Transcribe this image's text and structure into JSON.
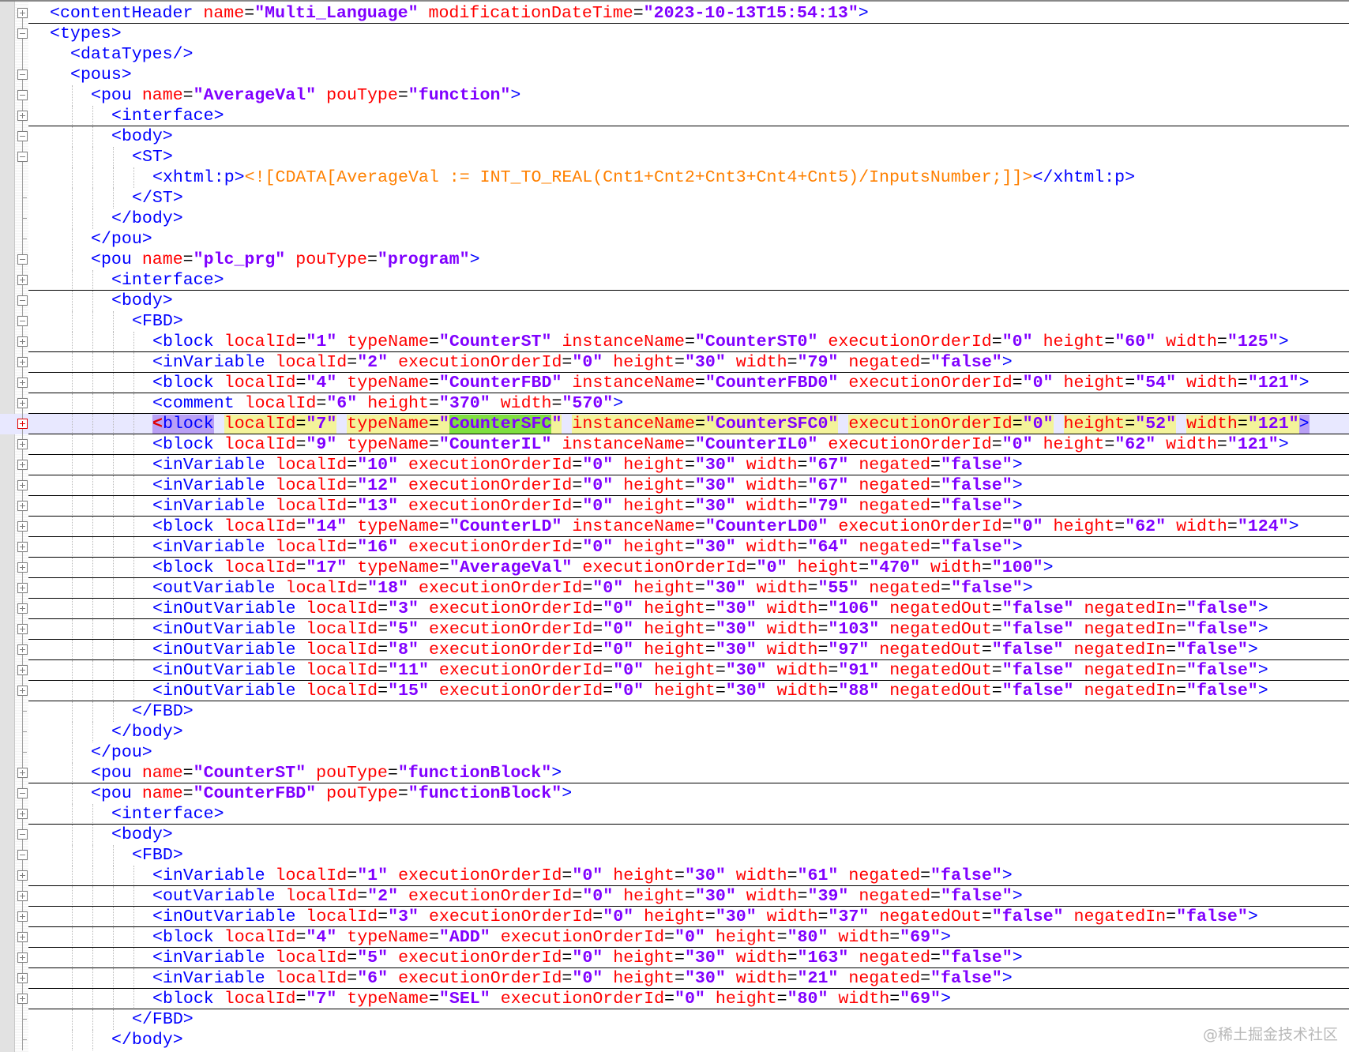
{
  "editor": {
    "lines": [
      {
        "i": 0,
        "f": "plus",
        "t": "<contentHeader name=\"Multi_Language\" modificationDateTime=\"2023-10-13T15:54:13\">"
      },
      {
        "i": 0,
        "f": "minus",
        "t": "<types>"
      },
      {
        "i": 1,
        "f": "none",
        "t": "<dataTypes/>"
      },
      {
        "i": 1,
        "f": "minus",
        "t": "<pous>"
      },
      {
        "i": 2,
        "f": "minus",
        "t": "<pou name=\"AverageVal\" pouType=\"function\">"
      },
      {
        "i": 3,
        "f": "plus",
        "t": "<interface>"
      },
      {
        "i": 3,
        "f": "minus",
        "t": "<body>"
      },
      {
        "i": 4,
        "f": "minus",
        "t": "<ST>"
      },
      {
        "i": 5,
        "f": "none",
        "t": "<xhtml:p><![CDATA[AverageVal := INT_TO_REAL(Cnt1+Cnt2+Cnt3+Cnt4+Cnt5)/InputsNumber;]]></xhtml:p>"
      },
      {
        "i": 4,
        "f": "end",
        "t": "</ST>"
      },
      {
        "i": 3,
        "f": "end",
        "t": "</body>"
      },
      {
        "i": 2,
        "f": "end",
        "t": "</pou>"
      },
      {
        "i": 2,
        "f": "minus",
        "t": "<pou name=\"plc_prg\" pouType=\"program\">"
      },
      {
        "i": 3,
        "f": "plus",
        "t": "<interface>"
      },
      {
        "i": 3,
        "f": "minus",
        "t": "<body>"
      },
      {
        "i": 4,
        "f": "minus",
        "t": "<FBD>"
      },
      {
        "i": 5,
        "f": "plus",
        "t": "<block localId=\"1\" typeName=\"CounterST\" instanceName=\"CounterST0\" executionOrderId=\"0\" height=\"60\" width=\"125\">"
      },
      {
        "i": 5,
        "f": "plus",
        "t": "<inVariable localId=\"2\" executionOrderId=\"0\" height=\"30\" width=\"79\" negated=\"false\">"
      },
      {
        "i": 5,
        "f": "plus",
        "t": "<block localId=\"4\" typeName=\"CounterFBD\" instanceName=\"CounterFBD0\" executionOrderId=\"0\" height=\"54\" width=\"121\">"
      },
      {
        "i": 5,
        "f": "plus",
        "t": "<comment localId=\"6\" height=\"370\" width=\"570\">"
      },
      {
        "i": 5,
        "f": "plus",
        "t": "<block localId=\"7\" typeName=\"CounterSFC\" instanceName=\"CounterSFC0\" executionOrderId=\"0\" height=\"52\" width=\"121\">",
        "hl": true,
        "match": "CounterSFC"
      },
      {
        "i": 5,
        "f": "plus",
        "t": "<block localId=\"9\" typeName=\"CounterIL\" instanceName=\"CounterIL0\" executionOrderId=\"0\" height=\"62\" width=\"121\">"
      },
      {
        "i": 5,
        "f": "plus",
        "t": "<inVariable localId=\"10\" executionOrderId=\"0\" height=\"30\" width=\"67\" negated=\"false\">"
      },
      {
        "i": 5,
        "f": "plus",
        "t": "<inVariable localId=\"12\" executionOrderId=\"0\" height=\"30\" width=\"67\" negated=\"false\">"
      },
      {
        "i": 5,
        "f": "plus",
        "t": "<inVariable localId=\"13\" executionOrderId=\"0\" height=\"30\" width=\"79\" negated=\"false\">"
      },
      {
        "i": 5,
        "f": "plus",
        "t": "<block localId=\"14\" typeName=\"CounterLD\" instanceName=\"CounterLD0\" executionOrderId=\"0\" height=\"62\" width=\"124\">"
      },
      {
        "i": 5,
        "f": "plus",
        "t": "<inVariable localId=\"16\" executionOrderId=\"0\" height=\"30\" width=\"64\" negated=\"false\">"
      },
      {
        "i": 5,
        "f": "plus",
        "t": "<block localId=\"17\" typeName=\"AverageVal\" executionOrderId=\"0\" height=\"470\" width=\"100\">"
      },
      {
        "i": 5,
        "f": "plus",
        "t": "<outVariable localId=\"18\" executionOrderId=\"0\" height=\"30\" width=\"55\" negated=\"false\">"
      },
      {
        "i": 5,
        "f": "plus",
        "t": "<inOutVariable localId=\"3\" executionOrderId=\"0\" height=\"30\" width=\"106\" negatedOut=\"false\" negatedIn=\"false\">"
      },
      {
        "i": 5,
        "f": "plus",
        "t": "<inOutVariable localId=\"5\" executionOrderId=\"0\" height=\"30\" width=\"103\" negatedOut=\"false\" negatedIn=\"false\">"
      },
      {
        "i": 5,
        "f": "plus",
        "t": "<inOutVariable localId=\"8\" executionOrderId=\"0\" height=\"30\" width=\"97\" negatedOut=\"false\" negatedIn=\"false\">"
      },
      {
        "i": 5,
        "f": "plus",
        "t": "<inOutVariable localId=\"11\" executionOrderId=\"0\" height=\"30\" width=\"91\" negatedOut=\"false\" negatedIn=\"false\">"
      },
      {
        "i": 5,
        "f": "plus",
        "t": "<inOutVariable localId=\"15\" executionOrderId=\"0\" height=\"30\" width=\"88\" negatedOut=\"false\" negatedIn=\"false\">"
      },
      {
        "i": 4,
        "f": "end",
        "t": "</FBD>"
      },
      {
        "i": 3,
        "f": "end",
        "t": "</body>"
      },
      {
        "i": 2,
        "f": "end",
        "t": "</pou>"
      },
      {
        "i": 2,
        "f": "plus",
        "t": "<pou name=\"CounterST\" pouType=\"functionBlock\">"
      },
      {
        "i": 2,
        "f": "minus",
        "t": "<pou name=\"CounterFBD\" pouType=\"functionBlock\">"
      },
      {
        "i": 3,
        "f": "plus",
        "t": "<interface>"
      },
      {
        "i": 3,
        "f": "minus",
        "t": "<body>"
      },
      {
        "i": 4,
        "f": "minus",
        "t": "<FBD>"
      },
      {
        "i": 5,
        "f": "plus",
        "t": "<inVariable localId=\"1\" executionOrderId=\"0\" height=\"30\" width=\"61\" negated=\"false\">"
      },
      {
        "i": 5,
        "f": "plus",
        "t": "<outVariable localId=\"2\" executionOrderId=\"0\" height=\"30\" width=\"39\" negated=\"false\">"
      },
      {
        "i": 5,
        "f": "plus",
        "t": "<inOutVariable localId=\"3\" executionOrderId=\"0\" height=\"30\" width=\"37\" negatedOut=\"false\" negatedIn=\"false\">"
      },
      {
        "i": 5,
        "f": "plus",
        "t": "<block localId=\"4\" typeName=\"ADD\" executionOrderId=\"0\" height=\"80\" width=\"69\">"
      },
      {
        "i": 5,
        "f": "plus",
        "t": "<inVariable localId=\"5\" executionOrderId=\"0\" height=\"30\" width=\"163\" negated=\"false\">"
      },
      {
        "i": 5,
        "f": "plus",
        "t": "<inVariable localId=\"6\" executionOrderId=\"0\" height=\"30\" width=\"21\" negated=\"false\">"
      },
      {
        "i": 5,
        "f": "plus",
        "t": "<block localId=\"7\" typeName=\"SEL\" executionOrderId=\"0\" height=\"80\" width=\"69\">"
      },
      {
        "i": 4,
        "f": "end",
        "t": "</FBD>"
      },
      {
        "i": 3,
        "f": "end",
        "t": "</body>"
      }
    ]
  },
  "watermark": "@稀土掘金技术社区",
  "colors": {
    "tag": "#0000ff",
    "attr": "#ff0000",
    "value": "#8000ff",
    "cdata": "#ff8000",
    "current_line": "#e8e8ff"
  }
}
